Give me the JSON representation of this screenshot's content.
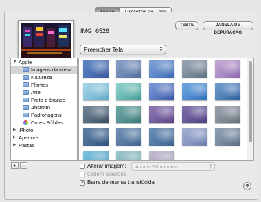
{
  "tabs": [
    "Mesa",
    "Protetor de Tela"
  ],
  "active_tab": 0,
  "current_image": {
    "name": "IMG_6526"
  },
  "buttons": {
    "test": "TESTE",
    "debug_window": "JANELA DE DEPURAÇÃO"
  },
  "fill_mode": {
    "value": "Preencher Tela"
  },
  "sources": {
    "groups": [
      {
        "label": "Apple",
        "expanded": true,
        "children": [
          {
            "label": "Imagens da Mesa",
            "selected": true
          },
          {
            "label": "Natureza"
          },
          {
            "label": "Plantas"
          },
          {
            "label": "Arte"
          },
          {
            "label": "Preto-e-branco"
          },
          {
            "label": "Abstrato"
          },
          {
            "label": "Padronagens"
          },
          {
            "label": "Cores Sólidas",
            "icon": "color-wheel-icon"
          }
        ]
      },
      {
        "label": "iPhoto",
        "expanded": false
      },
      {
        "label": "Aperture",
        "expanded": false
      },
      {
        "label": "Pastas",
        "expanded": false
      }
    ]
  },
  "thumbnails": [
    [
      "#5b86c4",
      "#3d5aa0"
    ],
    [
      "#8aa2c8",
      "#506c9e"
    ],
    [
      "#7fa3d6",
      "#3a69b4"
    ],
    [
      "#9aa6b4",
      "#5d6f84"
    ],
    [
      "#c7a9d6",
      "#8d6aae"
    ],
    [
      "#a9d6e6",
      "#5ea9c8"
    ],
    [
      "#8fd6cc",
      "#3f9a98"
    ],
    [
      "#7e9ad8",
      "#3656a6"
    ],
    [
      "#6da8e0",
      "#2f6fbd"
    ],
    [
      "#6fa0d0",
      "#2d5e9c"
    ],
    [
      "#6f8698",
      "#3c4e5f"
    ],
    [
      "#6aa6a4",
      "#3d7b7a"
    ],
    [
      "#8e78b4",
      "#5c4487"
    ],
    [
      "#7e6fae",
      "#4d3f80"
    ],
    [
      "#9aa2ac",
      "#6a727e"
    ],
    [
      "#5c7ea4",
      "#34557e"
    ],
    [
      "#6f90b8",
      "#42658f"
    ],
    [
      "#6a8fb9",
      "#3e638e"
    ],
    [
      "#a3afd4",
      "#6e7fae"
    ],
    [
      "#8fa2b6",
      "#5e6f84"
    ],
    [
      "#7fc4e0",
      "#3c8fb8"
    ],
    [
      "#9cc8cc",
      "#6a9ea2"
    ],
    [
      "#c2bcd0",
      "#9a92ac"
    ]
  ],
  "change_picture": {
    "label": "Alterar imagem:",
    "checked": false,
    "interval": "A cada 30 minutos"
  },
  "random_order": {
    "label": "Ordem aleatória",
    "checked": false
  },
  "translucent_menu": {
    "label": "Barra de menus translúcida",
    "checked": true
  },
  "source_controls": {
    "add": "+",
    "remove": "−"
  },
  "help": "?"
}
